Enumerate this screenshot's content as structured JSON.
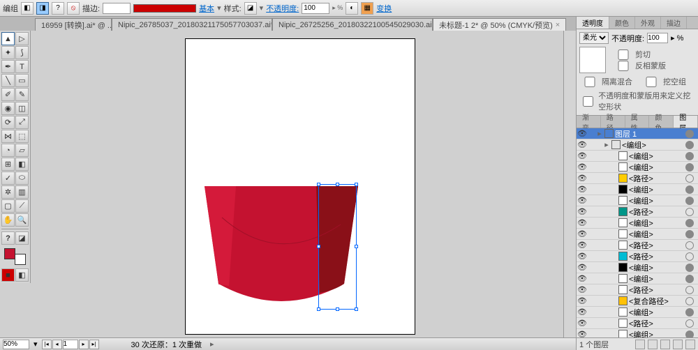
{
  "topbar": {
    "group": "编组",
    "anchor": "描边:",
    "basic": "基本",
    "style": "样式:",
    "opacity": "不透明度:",
    "opacity_val": "100",
    "transform": "变换"
  },
  "tabs": [
    {
      "label": "16959 [转换].ai* @ ..."
    },
    {
      "label": "Nipic_26785037_20180321175057703037.ai* ..."
    },
    {
      "label": "Nipic_26725256_20180322100545029030.ai* ..."
    },
    {
      "label": "未标题-1 2* @ 50% (CMYK/预览)",
      "active": true
    }
  ],
  "panel_tabs1": [
    "透明度",
    "颜色",
    "外观",
    "描边"
  ],
  "panel_tabs2": [
    "渐变",
    "路径",
    "属性",
    "颜色",
    "图层"
  ],
  "transparency": {
    "blend": "柔光",
    "op_label": "不透明度:",
    "op_val": "100",
    "clip": "剪切",
    "invert": "反相蒙版",
    "isolate": "隔离混合",
    "knockout": "挖空组",
    "opmask": "不透明度和蒙版用来定义挖空形状"
  },
  "layers": [
    {
      "name": "图层 1",
      "sw": "#4a7fd0",
      "sel": true,
      "depth": 0,
      "t": true
    },
    {
      "name": "<编组>",
      "sw": "none",
      "depth": 1,
      "t": true
    },
    {
      "name": "<编组>",
      "sw": "#fff",
      "depth": 2,
      "t": true
    },
    {
      "name": "<编组>",
      "sw": "#fff",
      "depth": 2,
      "t": true
    },
    {
      "name": "<路径>",
      "sw": "#ffcc00",
      "depth": 2,
      "t": false
    },
    {
      "name": "<编组>",
      "sw": "#000",
      "depth": 2,
      "t": true
    },
    {
      "name": "<编组>",
      "sw": "#fff",
      "depth": 2,
      "t": true
    },
    {
      "name": "<路径>",
      "sw": "#009688",
      "depth": 2,
      "t": false
    },
    {
      "name": "<编组>",
      "sw": "#fff",
      "depth": 2,
      "t": true
    },
    {
      "name": "<编组>",
      "sw": "#fff",
      "depth": 2,
      "t": true
    },
    {
      "name": "<路径>",
      "sw": "#fff",
      "depth": 2,
      "t": false
    },
    {
      "name": "<路径>",
      "sw": "#00bcd4",
      "depth": 2,
      "t": false
    },
    {
      "name": "<编组>",
      "sw": "#000",
      "depth": 2,
      "t": true
    },
    {
      "name": "<编组>",
      "sw": "#fff",
      "depth": 2,
      "t": true
    },
    {
      "name": "<路径>",
      "sw": "#fff",
      "depth": 2,
      "t": false
    },
    {
      "name": "<复合路径>",
      "sw": "#ffc107",
      "depth": 2,
      "t": false
    },
    {
      "name": "<编组>",
      "sw": "#fff",
      "depth": 2,
      "t": true
    },
    {
      "name": "<路径>",
      "sw": "#fff",
      "depth": 2,
      "t": false
    },
    {
      "name": "<编组>",
      "sw": "#fff",
      "depth": 2,
      "t": true
    }
  ],
  "layer_footer": "1 个图层",
  "status": {
    "zoom": "50%",
    "page": "1",
    "undo": "30 次还原：1 次重做"
  }
}
